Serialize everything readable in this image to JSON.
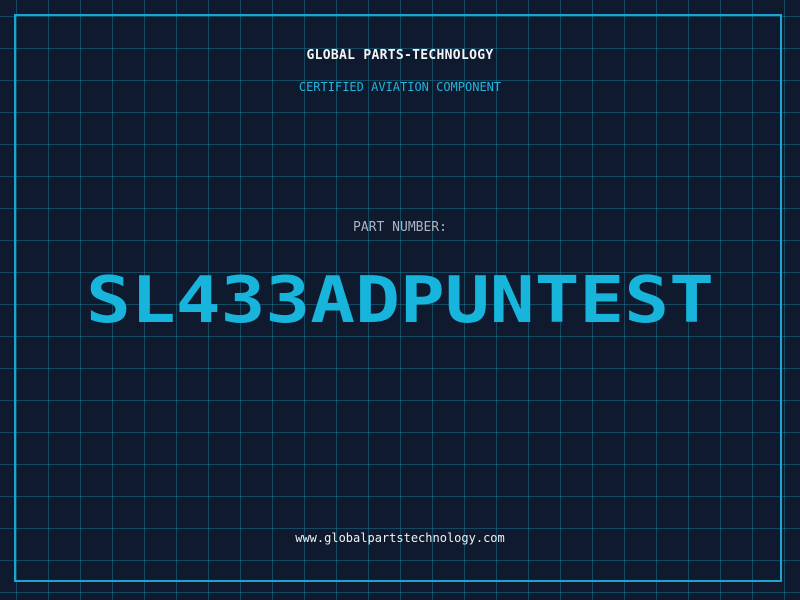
{
  "header": {
    "company_name": "GLOBAL PARTS-TECHNOLOGY",
    "subtitle": "CERTIFIED AVIATION COMPONENT"
  },
  "part": {
    "label": "PART NUMBER:",
    "number": "SL433ADPUNTEST"
  },
  "footer": {
    "website": "www.globalpartstechnology.com"
  },
  "colors": {
    "background": "#101a2e",
    "grid": "#188caa",
    "accent": "#1aa6cf",
    "part_number": "#17b4dc"
  }
}
